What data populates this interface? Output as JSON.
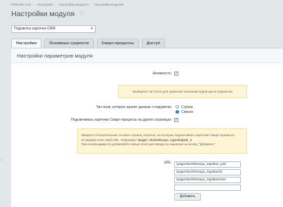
{
  "breadcrumbs": [
    "Рабочий стол",
    "Настройки",
    "Настройки продукта",
    "Настройки модулей"
  ],
  "page_title": "Настройки модуля",
  "module_select": {
    "value": "Подсветка карточек CRM"
  },
  "tabs": [
    "Настройки",
    "Основные сущности",
    "Смарт-процессы",
    "Доступ"
  ],
  "panel_title": "Настройки параметров модуля",
  "fields": {
    "activity_label": "Активность:",
    "activity_checked": true,
    "info_note": "Выберите тип поля для хранения значений кодов цвета подсветки",
    "field_type_label": "Тип поля, которое хранит данные о подсветке:",
    "radio_options": [
      "Строка",
      "Список"
    ],
    "radio_selected": "Список",
    "highlight_label": "Подсвечивать карточки Смарт-процесса на других страницах:",
    "highlight_checked": true,
    "hint_line1": "Введите относительные ссылки страниц портала, на которых подсвечивать карточки Смарт-процесса.",
    "hint_line2_prefix": "В каждом поле свой URL. Например:",
    "hint_line2_example": "/page/_sluzhebnaya_zapiska/pdz_2",
    "hint_line3": "При необходимости добавляйте новые поля для ввода по нажатию на кнопку \"Добавить\"",
    "url_label": "URL:",
    "urls": [
      "/page/sluzhebnaya_zapiska/_pdz",
      "/page/sluzhebnaya_zapiska/sd",
      "/page/sluzhebnaya_zapiska/novo",
      ""
    ],
    "add_button": "Добавить"
  }
}
